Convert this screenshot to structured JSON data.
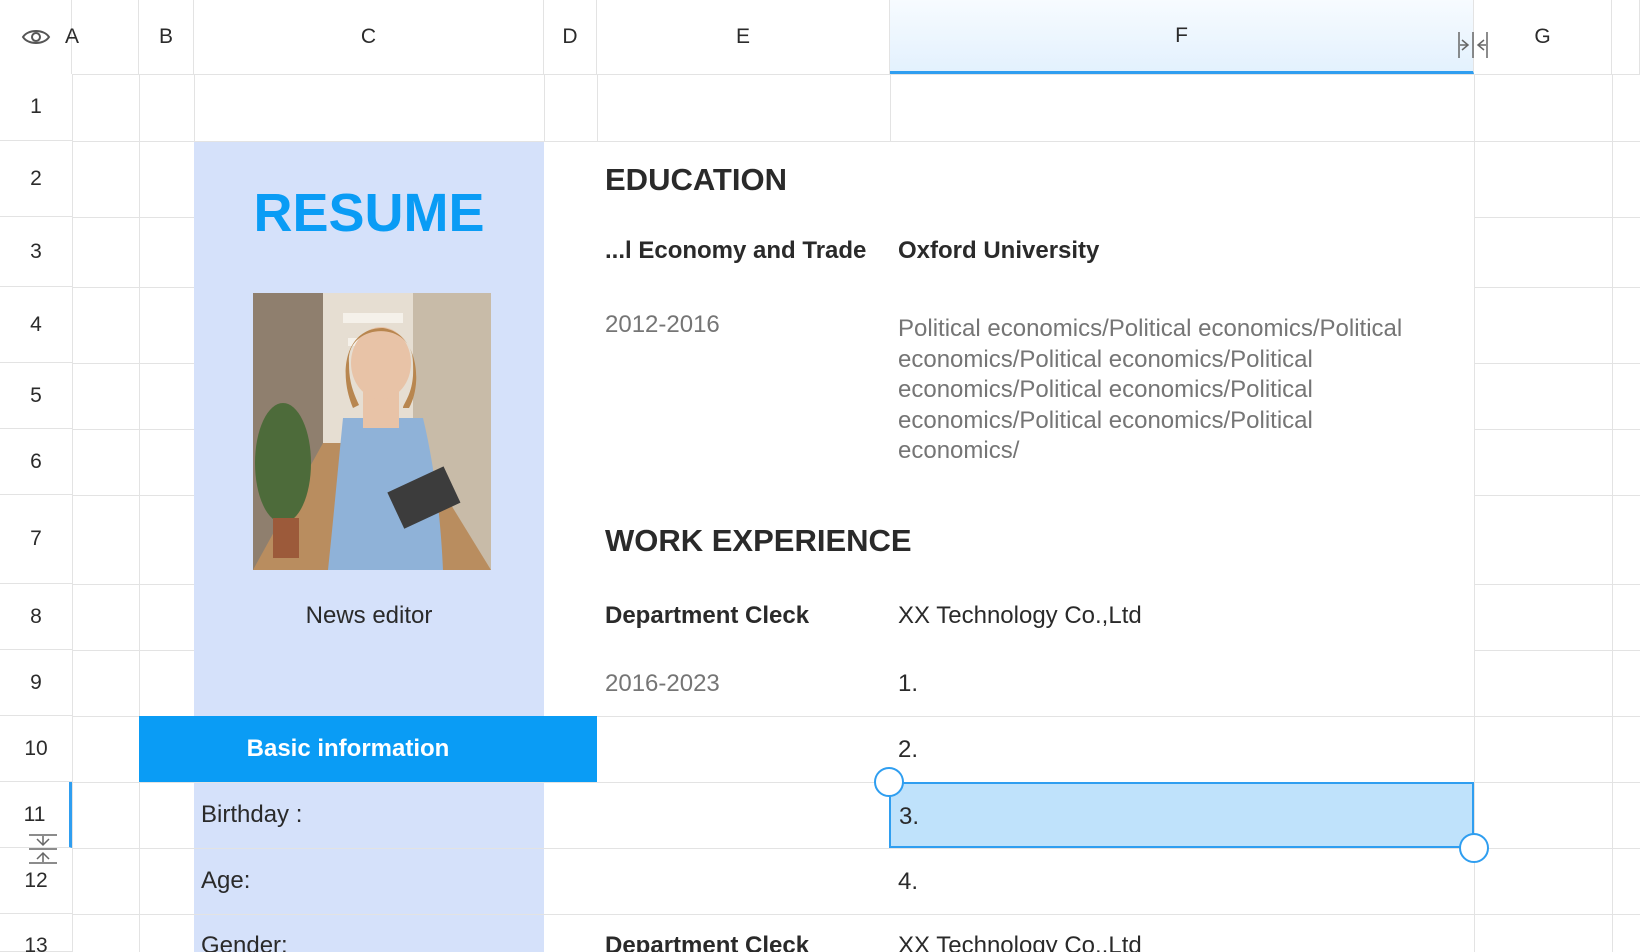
{
  "columns": [
    {
      "id": "A",
      "label": "A"
    },
    {
      "id": "B",
      "label": "B"
    },
    {
      "id": "C",
      "label": "C"
    },
    {
      "id": "D",
      "label": "D"
    },
    {
      "id": "E",
      "label": "E"
    },
    {
      "id": "F",
      "label": "F"
    },
    {
      "id": "G",
      "label": "G"
    }
  ],
  "rows": [
    "1",
    "2",
    "3",
    "4",
    "5",
    "6",
    "7",
    "8",
    "9",
    "10",
    "11",
    "12",
    "13"
  ],
  "resume": {
    "title": "RESUME",
    "job_title": "News editor",
    "basic_info_header": "Basic information",
    "birthday_label": "Birthday :",
    "age_label": "Age:",
    "gender_label": "Gender:"
  },
  "education": {
    "heading": "EDUCATION",
    "major": "...l Economy and Trade",
    "school": "Oxford University",
    "years": "2012-2016",
    "description_lines": [
      "Political economics/Political economics/Political",
      "economics/Political economics/Political",
      "economics/Political economics/Political",
      "economics/Political economics/Political",
      "economics/"
    ]
  },
  "work": {
    "heading": "WORK EXPERIENCE",
    "position": "Department Cleck",
    "company": "XX Technology Co.,Ltd",
    "years": "2016-2023",
    "items": [
      "1.",
      "2.",
      "3.",
      "4."
    ],
    "position_2": "Department Cleck",
    "company_2": "XX Technology Co.,Ltd"
  },
  "colors": {
    "accent": "#0a9cf5",
    "panel": "#d5e1fa",
    "selection": "#bfe2fb"
  }
}
